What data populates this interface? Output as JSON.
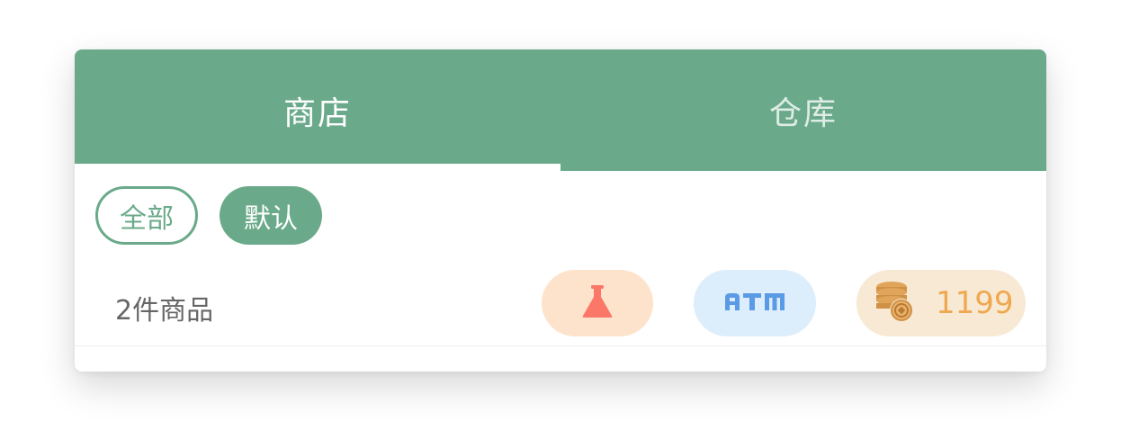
{
  "tabs": [
    {
      "label": "商店",
      "active": true
    },
    {
      "label": "仓库",
      "active": false
    }
  ],
  "filters": [
    {
      "label": "全部",
      "style": "outline"
    },
    {
      "label": "默认",
      "style": "filled"
    }
  ],
  "item_count": "2件商品",
  "resources": {
    "potion_icon": "flask-icon",
    "atm_icon": "atm-icon",
    "coin_icon": "coins-icon",
    "coin_value": "1199"
  },
  "colors": {
    "primary": "#6aaa8a",
    "potion_bg": "#fde3cc",
    "flask": "#fb7868",
    "atm_bg": "#dcedfb",
    "atm": "#5b9be6",
    "coins_bg": "#f7e9d3",
    "coins": "#f0a850"
  }
}
